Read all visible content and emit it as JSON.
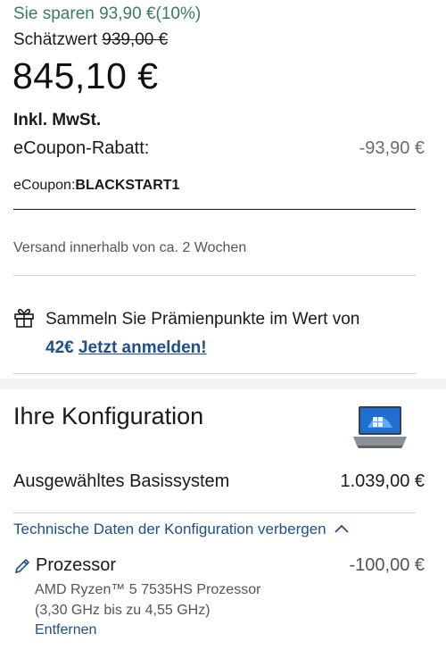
{
  "pricing": {
    "savings_text": "Sie sparen 93,90 €(10%)",
    "estimate_label": "Schätzwert ",
    "estimate_value": "939,00 €",
    "price": "845,10 €",
    "vat": "Inkl. MwSt.",
    "coupon_label": "eCoupon-Rabatt:",
    "coupon_amount": "-93,90 €",
    "coupon_code_label": "eCoupon:",
    "coupon_code": "BLACKSTART1"
  },
  "shipping": {
    "text": "Versand innerhalb von ca. 2 Wochen"
  },
  "rewards": {
    "text": "Sammeln Sie Prämienpunkte im Wert von",
    "points": "42€",
    "join_link": "Jetzt anmelden!"
  },
  "configuration": {
    "title": "Ihre Konfiguration",
    "base_label": "Ausgewähltes Basissystem",
    "base_price": "1.039,00 €",
    "toggle_link": "Technische Daten der Konfiguration verbergen",
    "processor": {
      "label": "Prozessor",
      "amount": "-100,00 €",
      "desc_line1": "AMD Ryzen™ 5 7535HS Prozessor",
      "desc_line2": "(3,30 GHz bis zu 4,55 GHz)",
      "remove": "Entfernen"
    }
  },
  "icons": {
    "gift": "gift-icon",
    "laptop": "laptop-image",
    "chevron": "chevron-up-icon",
    "pencil": "pencil-icon"
  },
  "colors": {
    "savings_green": "#3a7a64",
    "link_blue": "#1d4f8c"
  }
}
